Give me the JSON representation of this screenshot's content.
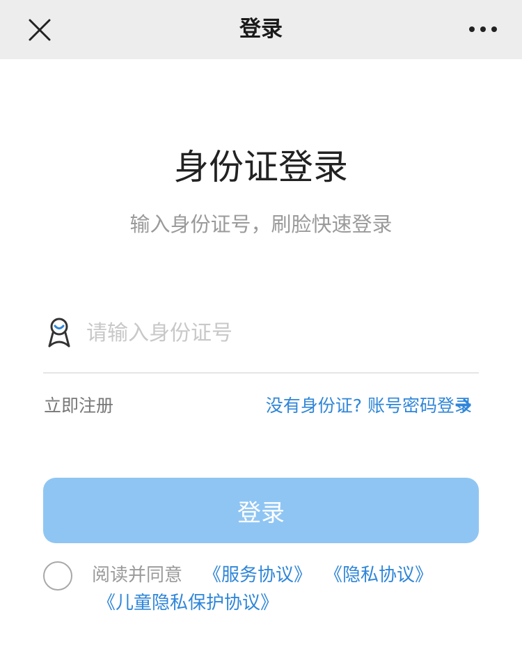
{
  "nav": {
    "title": "登录",
    "close_icon": "close-icon",
    "more_icon": "more-horizontal-icon"
  },
  "main": {
    "title": "身份证登录",
    "subtitle": "输入身份证号，刷脸快速登录"
  },
  "form": {
    "id_placeholder": "请输入身份证号",
    "id_value": "",
    "person_icon": "person-icon",
    "register_label": "立即注册",
    "alt_login_label": "没有身份证? 账号密码登录",
    "arrow_icon": "arrow-right-icon",
    "login_button_label": "登录"
  },
  "agreement": {
    "checked": false,
    "prefix": "阅读并同意",
    "service": "《服务协议》",
    "privacy": "《隐私协议》",
    "child_privacy": "《儿童隐私保护协议》"
  },
  "colors": {
    "nav_bg": "#ededed",
    "link": "#2f86d8",
    "button_bg": "#8fc5f3",
    "icon_accent": "#2f86d8"
  }
}
